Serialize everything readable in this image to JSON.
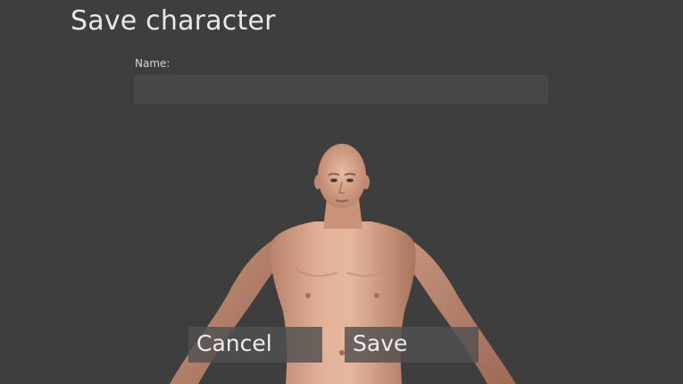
{
  "dialog": {
    "title": "Save character",
    "name_label": "Name:",
    "name_value": "",
    "name_placeholder": ""
  },
  "buttons": {
    "cancel_label": "Cancel",
    "save_label": "Save"
  },
  "colors": {
    "background": "#3e3e3e",
    "input_bg": "#484848",
    "button_bg": "#505050",
    "text": "#e8e8e8",
    "skin": "#d9a78a"
  }
}
